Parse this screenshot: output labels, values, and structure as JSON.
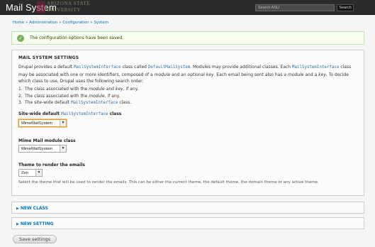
{
  "header": {
    "title": "Mail System",
    "logo_line1": "ARIZONA STATE",
    "logo_line2": "UNIVERSITY",
    "search_placeholder": "Search ASU",
    "search_button": "Search"
  },
  "breadcrumb": [
    "Home",
    "Administration",
    "Configuration",
    "System"
  ],
  "breadcrumb_separator": "»",
  "status": {
    "icon": "check-icon",
    "message": "The configuration options have been saved."
  },
  "settings": {
    "legend": "MAIL SYSTEM SETTINGS",
    "desc_parts": [
      "Drupal provides a default ",
      "MailSystemInterface",
      " class called ",
      "DefaultMailSystem",
      ". Modules may provide additional classes. Each ",
      "MailSystemInterface",
      " class may be associated with one or more identifiers, composed of a ",
      "module",
      " and an optional ",
      "key",
      ". Each email being sent also has a ",
      "module",
      " and a ",
      "key",
      ". To decide which class to use, Drupal uses the following search order:"
    ],
    "order": [
      {
        "num": "1.",
        "a": "The class associated with the ",
        "b": "module",
        "c": " and ",
        "d": "key",
        "e": ", if any."
      },
      {
        "num": "2.",
        "a": "The class associated with the ",
        "b": "module",
        "c": ", if any.",
        "d": "",
        "e": ""
      },
      {
        "num": "3.",
        "a": "The site-wide default ",
        "b": "MailSystemInterface",
        "c": " class.",
        "d": "",
        "e": ""
      }
    ],
    "sitewide": {
      "label_a": "Site-wide default ",
      "label_code": "MailSystemInterface",
      "label_b": " class",
      "value": "MimeMailSystem"
    },
    "mime": {
      "label": "Mime Mail module class",
      "value": "MimeMailSystem"
    },
    "theme": {
      "label": "Theme to render the emails",
      "value": "Zen",
      "help": "Select the theme that will be used to render the emails. This can be either the current theme, the default theme, the domain theme or any active theme."
    }
  },
  "new_class": "NEW CLASS",
  "new_setting": "NEW SETTING",
  "save_button": "Save settings"
}
